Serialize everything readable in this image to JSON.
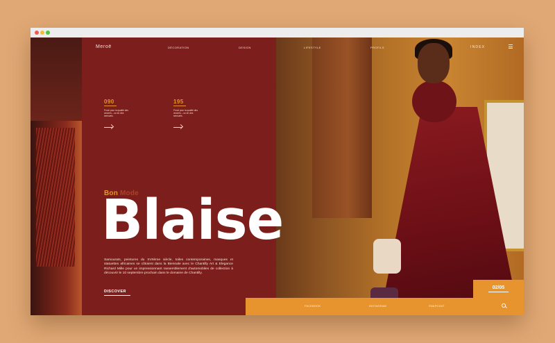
{
  "window": {
    "traffic_lights": [
      "close",
      "minimize",
      "zoom"
    ]
  },
  "header": {
    "logo": "Meroë",
    "nav": [
      "DÉCORATION",
      "DESIGN",
      "LIFESTYLE",
      "PROFILS"
    ],
    "index_label": "INDEX",
    "menu_icon": "hamburger-icon"
  },
  "stats": [
    {
      "number": "090",
      "text": "Ponzi pour la qualité des œuvres – ou en des sensuels."
    },
    {
      "number": "195",
      "text": "Ponzi pour la qualité des œuvres – ou en des sensuels."
    }
  ],
  "hero": {
    "kicker_part1": "Bon",
    "kicker_part2": "Mode",
    "title": "Blaise",
    "body": "Samouraïs, peintures du XVIIème siècle, toiles contemporaines, masques et statuettes africaines se côtoient dans la Biennale avec le Chantilly Art & Elegance Richard Mille pour un impressionnant rassemblement d'automobiles de collection à découvrir le 10 septembre prochain dans le domaine de Chantilly.",
    "cta": "DISCOVER"
  },
  "slide_counter": "02/05",
  "footer": {
    "links": [
      "FACEBOOK",
      "INSTAGRAM",
      "SNAPCHAT"
    ],
    "search_icon": "search-icon"
  },
  "colors": {
    "background": "#e0a874",
    "panel": "#7c1e1b",
    "accent": "#e7932e",
    "text": "#ffffff"
  }
}
